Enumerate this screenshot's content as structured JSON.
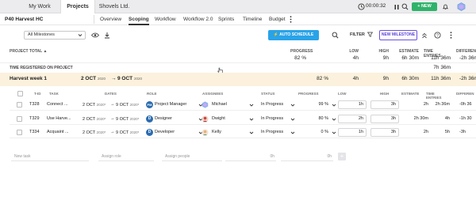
{
  "topbar": {
    "tabs": [
      {
        "label": "My Work"
      },
      {
        "label": "Projects"
      },
      {
        "label": "Shovels Ltd."
      }
    ],
    "timer": "00:00:32",
    "new_label": "NEW"
  },
  "subbar": {
    "project": "P40 Harvest HC",
    "nav": [
      {
        "label": "Overview"
      },
      {
        "label": "Scoping"
      },
      {
        "label": "Workflow"
      },
      {
        "label": "Workflow 2.0"
      },
      {
        "label": "Sprints"
      },
      {
        "label": "Timeline"
      },
      {
        "label": "Budget"
      }
    ]
  },
  "toolbar": {
    "milestone_select": "All Milestones",
    "auto_schedule": "AUTO SCHEDULE",
    "filter": "FILTER",
    "new_milestone": "NEW MILESTONE"
  },
  "totals": {
    "headers": {
      "project_total": "PROJECT TOTAL",
      "progress": "PROGRESS",
      "low": "LOW",
      "high": "HIGH",
      "estimate": "ESTIMATE",
      "time_entries": "TIME ENTRIES",
      "difference": "DIFFEREN"
    },
    "values": {
      "progress": "82 %",
      "low": "4h",
      "high": "9h",
      "estimate": "6h 30m",
      "time_entries": "11h 36m",
      "difference": "-2h 36m"
    },
    "registered_label": "TIME REGISTERED ON PROJECT",
    "registered_value": "7h 36m"
  },
  "milestone": {
    "name": "Harvest week 1",
    "start": "2 OCT",
    "start_year": "2020",
    "end": "9 OCT",
    "end_year": "2020",
    "progress": "82 %",
    "low": "4h",
    "high": "9h",
    "estimate": "6h 30m",
    "time_entries": "11h 36m",
    "difference": "-2h 36m"
  },
  "columns": {
    "tid": "T-ID",
    "task": "TASK",
    "dates": "DATES",
    "role": "ROLE",
    "assignees": "ASSIGNEES",
    "status": "STATUS",
    "progress": "PROGRESS",
    "low": "LOW",
    "high": "HIGH",
    "estimate": "ESTIMATE",
    "time_entries": "TIME ENTRIES",
    "difference": "DIFFEREN"
  },
  "tasks": [
    {
      "id": "T328",
      "name": "Connect ...",
      "start": "2 OCT",
      "start_year": "2020",
      "end": "9 OCT",
      "end_year": "2020",
      "role_initials": "PM",
      "role": "Project Manager",
      "assignee": "Michael",
      "status": "In Progress",
      "progress": "99 %",
      "low": "1h",
      "high": "3h",
      "estimate": "2h",
      "time_entries": "2h 36m",
      "difference": "-0h 36"
    },
    {
      "id": "T329",
      "name": "Use Harve...",
      "start": "2 OCT",
      "start_year": "2020",
      "end": "9 OCT",
      "end_year": "2020",
      "role_initials": "D",
      "role": "Designer",
      "assignee": "Dwight",
      "status": "In Progress",
      "progress": "80 %",
      "low": "2h",
      "high": "3h",
      "estimate": "2h 30m",
      "time_entries": "4h",
      "difference": "-1h 30"
    },
    {
      "id": "T334",
      "name": "Acquaint ...",
      "start": "2 OCT",
      "start_year": "2020",
      "end": "9 OCT",
      "end_year": "2020",
      "role_initials": "D",
      "role": "Developer",
      "assignee": "Kelly",
      "status": "In Progress",
      "progress": "0 %",
      "low": "1h",
      "high": "3h",
      "estimate": "2h",
      "time_entries": "5h",
      "difference": "-3h"
    }
  ],
  "add_row": {
    "task_placeholder": "New task",
    "role_placeholder": "Assign role",
    "people_placeholder": "Assign people",
    "low": "0h",
    "high": "0h"
  }
}
